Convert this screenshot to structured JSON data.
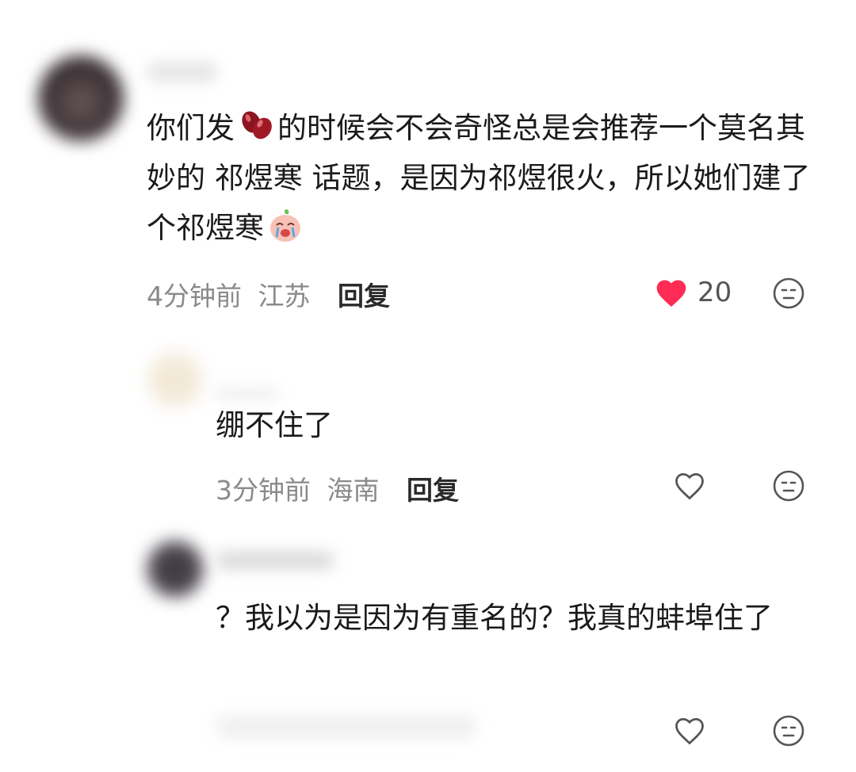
{
  "comments": [
    {
      "text_parts": [
        "你们发",
        "的时候会不会奇怪总是会推荐一个莫名其妙的 祁煜寒 话题，是因为祁煜很火，所以她们建了个祁煜寒"
      ],
      "emoji": [
        "red-beans-emoji",
        "crying-peach-emoji"
      ],
      "time": "4分钟前",
      "location": "江苏",
      "reply_label": "回复",
      "likes": "20",
      "liked": true
    },
    {
      "text": "绷不住了",
      "time": "3分钟前",
      "location": "海南",
      "reply_label": "回复",
      "liked": false
    },
    {
      "text": "？我以为是因为有重名的？我真的蚌埠住了",
      "liked": false
    }
  ],
  "colors": {
    "like_active": "#fe2c55",
    "meta_text": "#8a8a8a"
  }
}
